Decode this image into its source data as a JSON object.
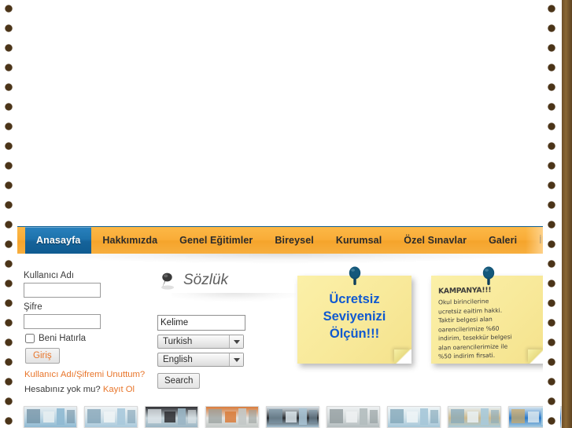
{
  "nav": {
    "items": [
      {
        "label": "Anasayfa",
        "active": true
      },
      {
        "label": "Hakkımızda",
        "active": false
      },
      {
        "label": "Genel Eğitimler",
        "active": false
      },
      {
        "label": "Bireysel",
        "active": false
      },
      {
        "label": "Kurumsal",
        "active": false
      },
      {
        "label": "Özel Sınavlar",
        "active": false
      },
      {
        "label": "Galeri",
        "active": false
      },
      {
        "label": "İletişim",
        "active": false
      }
    ],
    "active_bg": "#15639a",
    "bar_bg": "#f9ac37"
  },
  "login": {
    "username_label": "Kullanıcı Adı",
    "username_value": "",
    "username_placeholder": "",
    "password_label": "Şifre",
    "password_value": "",
    "password_placeholder": "",
    "remember_label": "Beni Hatırla",
    "remember_checked": false,
    "submit_label": "Giriş",
    "forgot_link": "Kullanıcı Adı/Şifremi Unuttum?",
    "signup_prefix": "Hesabınız yok mu?",
    "signup_link": "Kayıt Ol",
    "link_color": "#e8752a"
  },
  "dictionary": {
    "title": "Sözlük",
    "pin_icon": "pushpin-icon",
    "word_value": "Kelime",
    "word_placeholder": "Kelime",
    "source_language": "Turkish",
    "target_language": "English",
    "search_label": "Search"
  },
  "notes": [
    {
      "id": "note-free",
      "pin_icon": "pushpin-icon",
      "lines": [
        "Ücretsiz",
        "Seviyenizi",
        "Ölçün!!!"
      ],
      "text_color": "#1059d0",
      "paper_color": "#f8e99a"
    },
    {
      "id": "note-promo",
      "pin_icon": "pushpin-icon",
      "headline": "KAMPANYA!!!",
      "lines": [
        "Okul birincilerine",
        "ucretsiz eaitim hakki.",
        "Taktir belgesi alan",
        "oarencilerimize %60",
        "indirim, tesekkür belgesi",
        "alan oarencilerimize ile",
        "%50 indirim firsati."
      ],
      "text_color": "#3b3b3b",
      "paper_color": "#f8e99a"
    }
  ],
  "gallery": {
    "count": 10,
    "thumbnails": [
      {
        "name": "thumb-1"
      },
      {
        "name": "thumb-2"
      },
      {
        "name": "thumb-3"
      },
      {
        "name": "thumb-4"
      },
      {
        "name": "thumb-5"
      },
      {
        "name": "thumb-6"
      },
      {
        "name": "thumb-7"
      },
      {
        "name": "thumb-8"
      },
      {
        "name": "thumb-9"
      },
      {
        "name": "thumb-10"
      }
    ]
  },
  "page": {
    "border_dot_color": "#4b3418",
    "background": "#ffffff"
  }
}
